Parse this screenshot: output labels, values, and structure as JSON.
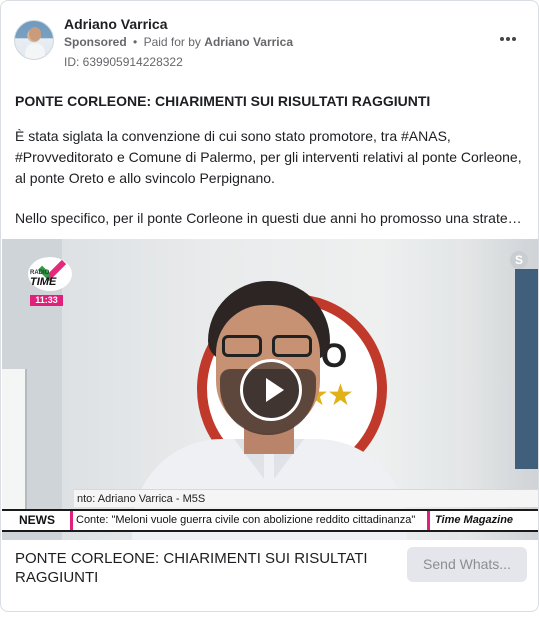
{
  "advertiser": {
    "name": "Adriano Varrica",
    "sponsored_label": "Sponsored",
    "separator": "•",
    "paid_for_prefix": "Paid for by",
    "paid_for_name": "Adriano Varrica",
    "ad_id": "ID: 639905914228322"
  },
  "icons": {
    "more": "more-options-icon",
    "play": "play-icon",
    "skype": "skype-icon"
  },
  "post": {
    "headline": "PONTE CORLEONE: CHIARIMENTI SUI RISULTATI RAGGIUNTI",
    "paragraph1": "È stata siglata la convenzione di cui sono stato promotore, tra #ANAS, #Provveditorato e Comune di Palermo, per gli interventi relativi al ponte Corleone, al ponte Oreto e allo svincolo Perpignano.",
    "paragraph2": "Nello specifico, per il ponte Corleone in questi due anni ho promosso una strategia..."
  },
  "video": {
    "channel_brand_top": "RADIO",
    "channel_brand": "TIME",
    "clock": "11:33",
    "backdrop_text": "MO  NTO",
    "lower_third": "nto: Adriano Varrica - M5S",
    "ticker_label": "NEWS",
    "ticker_text": "Conte: \"Meloni vuole guerra civile con abolizione reddito cittadinanza\"",
    "ticker_source": "Time Magazine"
  },
  "footer": {
    "title": "PONTE CORLEONE: CHIARIMENTI SUI RISULTATI RAGGIUNTI",
    "cta_label": "Send Whats..."
  },
  "colors": {
    "accent_pink": "#e0207a",
    "cta_bg": "#e4e6eb",
    "meta_text": "#65676b"
  }
}
